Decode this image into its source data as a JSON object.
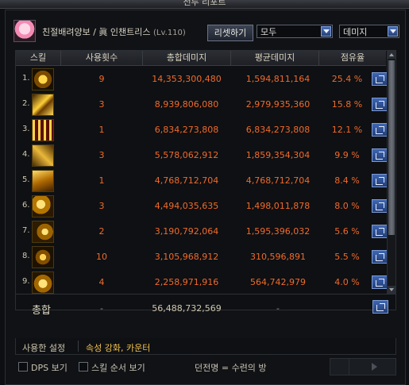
{
  "window": {
    "title": "전투 리포트"
  },
  "header": {
    "character": "친절배려양보 / ",
    "character_class": "眞 인챈트리스",
    "level": "(Lv.110)",
    "reset_label": "리셋하기",
    "filter_value": "모두",
    "sort_value": "데미지"
  },
  "table": {
    "columns": [
      "스킬",
      "사용횟수",
      "총합데미지",
      "평균데미지",
      "점유율"
    ],
    "rows": [
      {
        "num": "1.",
        "uses": "9",
        "total": "14,353,300,480",
        "avg": "1,594,811,164",
        "share": "25.4 %",
        "icon": "skill-icon-1"
      },
      {
        "num": "2.",
        "uses": "3",
        "total": "8,939,806,080",
        "avg": "2,979,935,360",
        "share": "15.8 %",
        "icon": "skill-icon-2"
      },
      {
        "num": "3.",
        "uses": "1",
        "total": "6,834,273,808",
        "avg": "6,834,273,808",
        "share": "12.1 %",
        "icon": "skill-icon-3"
      },
      {
        "num": "4.",
        "uses": "3",
        "total": "5,578,062,912",
        "avg": "1,859,354,304",
        "share": "9.9 %",
        "icon": "skill-icon-4"
      },
      {
        "num": "5.",
        "uses": "1",
        "total": "4,768,712,704",
        "avg": "4,768,712,704",
        "share": "8.4 %",
        "icon": "skill-icon-5"
      },
      {
        "num": "6.",
        "uses": "3",
        "total": "4,494,035,635",
        "avg": "1,498,011,878",
        "share": "8.0 %",
        "icon": "skill-icon-6"
      },
      {
        "num": "7.",
        "uses": "2",
        "total": "3,190,792,064",
        "avg": "1,595,396,032",
        "share": "5.6 %",
        "icon": "skill-icon-7"
      },
      {
        "num": "8.",
        "uses": "10",
        "total": "3,105,968,912",
        "avg": "310,596,891",
        "share": "5.5 %",
        "icon": "skill-icon-8"
      },
      {
        "num": "9.",
        "uses": "4",
        "total": "2,258,971,916",
        "avg": "564,742,979",
        "share": "4.0 %",
        "icon": "skill-icon-9"
      }
    ],
    "total": {
      "label": "총합",
      "uses": "-",
      "total": "56,488,732,569",
      "avg": "-"
    }
  },
  "settings": {
    "label": "사용한 설정",
    "value": "속성 강화, 카운터"
  },
  "footer": {
    "dps_label": "DPS 보기",
    "order_label": "스킬 순서 보기",
    "dungeon": "던전명 = 수련의 방"
  },
  "colors": {
    "accent": "#f06a2a",
    "highlight": "#f2c14e",
    "button": "#3f66b3"
  }
}
